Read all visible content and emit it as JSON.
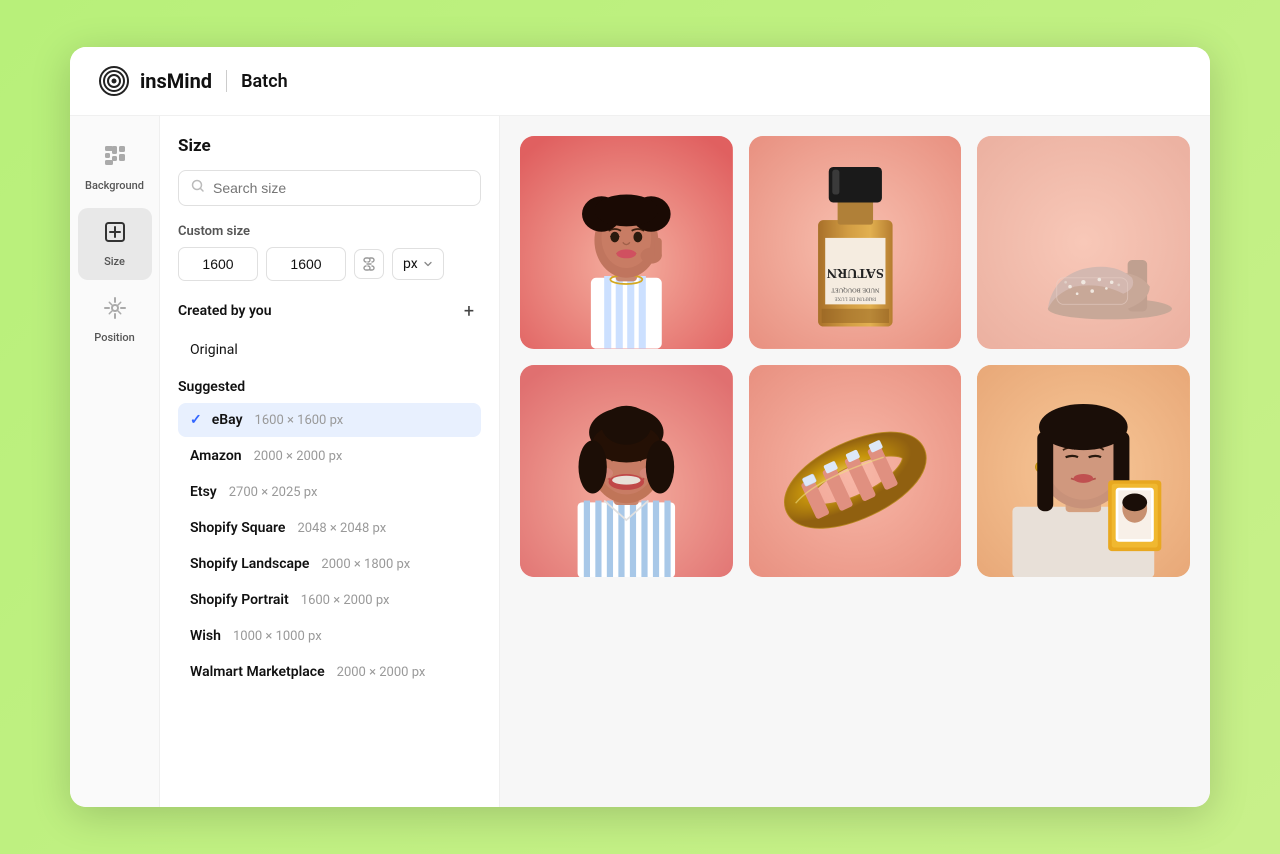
{
  "header": {
    "logo_text": "insMind",
    "separator": "|",
    "batch_label": "Batch"
  },
  "sidebar": {
    "items": [
      {
        "id": "background",
        "label": "Background",
        "icon": "grid"
      },
      {
        "id": "size",
        "label": "Size",
        "icon": "size",
        "active": true
      },
      {
        "id": "position",
        "label": "Position",
        "icon": "position"
      }
    ]
  },
  "panel": {
    "title": "Size",
    "search_placeholder": "Search size",
    "custom_size": {
      "label": "Custom size",
      "width": "1600",
      "height": "1600",
      "unit": "px"
    },
    "created_by_you": {
      "label": "Created by you",
      "original_label": "Original"
    },
    "suggested": {
      "label": "Suggested",
      "items": [
        {
          "name": "eBay",
          "dims": "1600 × 1600 px",
          "selected": true
        },
        {
          "name": "Amazon",
          "dims": "2000 × 2000 px",
          "selected": false
        },
        {
          "name": "Etsy",
          "dims": "2700 × 2025 px",
          "selected": false
        },
        {
          "name": "Shopify Square",
          "dims": "2048 × 2048 px",
          "selected": false
        },
        {
          "name": "Shopify Landscape",
          "dims": "2000 × 1800 px",
          "selected": false
        },
        {
          "name": "Shopify Portrait",
          "dims": "1600 × 2000 px",
          "selected": false
        },
        {
          "name": "Wish",
          "dims": "1000 × 1000 px",
          "selected": false
        },
        {
          "name": "Walmart Marketplace",
          "dims": "2000 × 2000 px",
          "selected": false
        }
      ]
    }
  },
  "images": [
    {
      "id": "woman1",
      "type": "portrait",
      "bg": "pink"
    },
    {
      "id": "perfume",
      "type": "product",
      "bg": "peach"
    },
    {
      "id": "shoe",
      "type": "product",
      "bg": "light-pink"
    },
    {
      "id": "woman2",
      "type": "portrait",
      "bg": "pink"
    },
    {
      "id": "ring",
      "type": "product",
      "bg": "salmon"
    },
    {
      "id": "woman3",
      "type": "portrait",
      "bg": "warm"
    }
  ],
  "colors": {
    "accent_blue": "#3b6af5",
    "selected_bg": "#e8effe",
    "sidebar_active_bg": "#e8e8e8",
    "green_bg": "#a8e063"
  }
}
